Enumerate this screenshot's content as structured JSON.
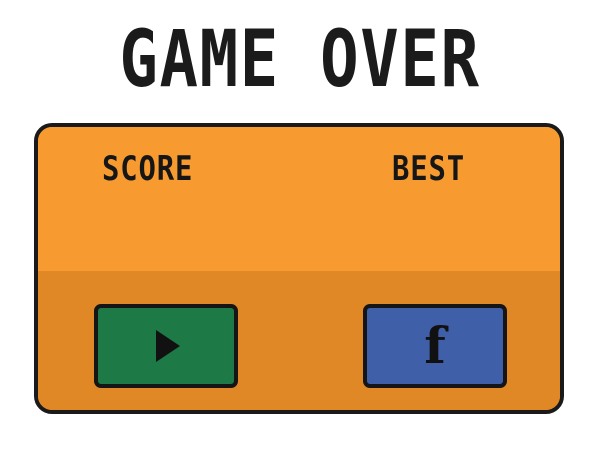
{
  "screen": {
    "title": "GAME OVER"
  },
  "panel": {
    "score_label": "SCORE",
    "best_label": "BEST",
    "colors": {
      "panel_top": "#f79b31",
      "panel_bottom": "#e08726",
      "play_button": "#1d7a46",
      "share_button": "#3f5fa8",
      "outline": "#1a1a1a"
    }
  },
  "buttons": {
    "play_icon": "play-icon",
    "share_icon": "facebook-icon",
    "share_glyph": "f"
  }
}
